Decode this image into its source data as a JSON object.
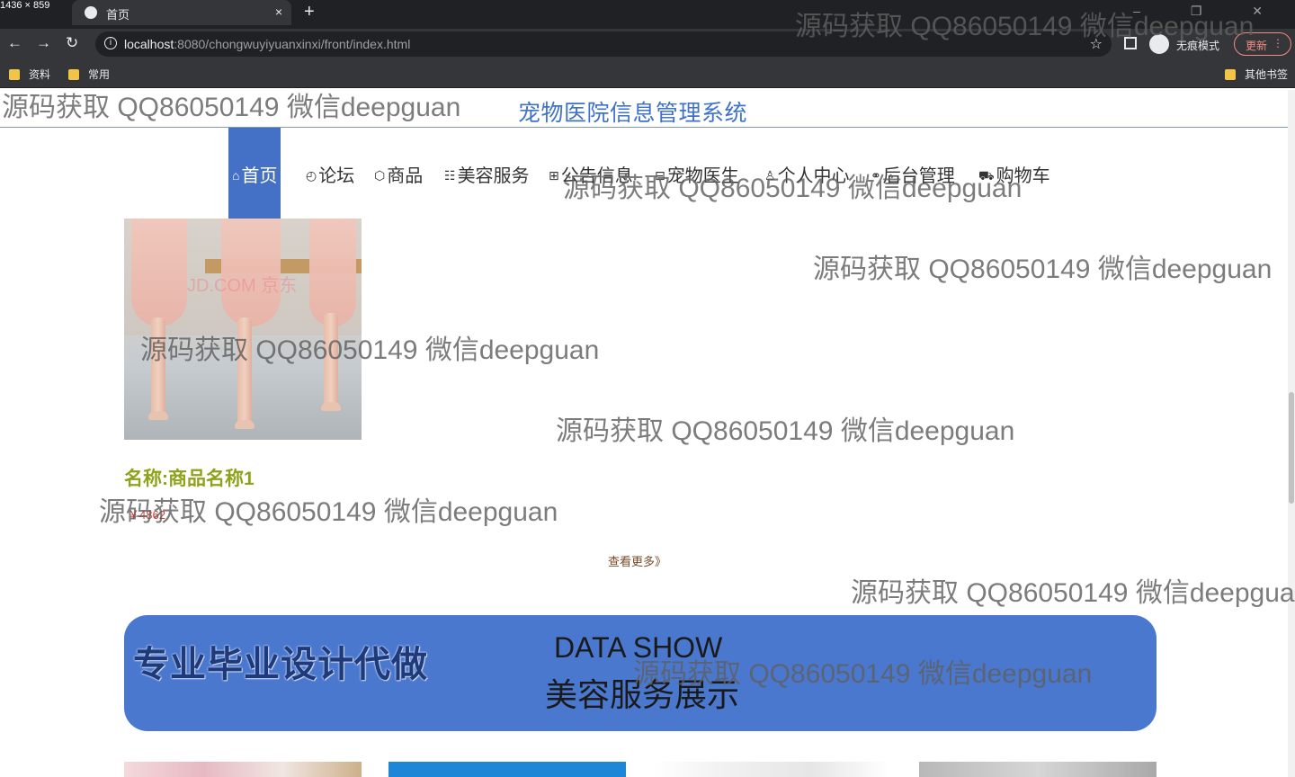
{
  "browser": {
    "corner_label": "1436 × 859",
    "tab_title": "首页",
    "tab_close": "×",
    "new_tab": "+",
    "window_controls": "– ❐ ✕",
    "url_host": "localhost",
    "url_rest": ":8080/chongwuyiyuanxinxi/front/index.html",
    "incognito_label": "无痕模式",
    "update_label": "更新",
    "bookmarks": [
      "资料",
      "常用"
    ],
    "other_bookmarks": "其他书签"
  },
  "site": {
    "title": "宠物医院信息管理系统"
  },
  "nav": {
    "items": [
      {
        "label": "首页",
        "icon": "home-icon",
        "active": true
      },
      {
        "label": "论坛",
        "icon": "clock-icon"
      },
      {
        "label": "商品",
        "icon": "box-icon"
      },
      {
        "label": "美容服务",
        "icon": "list-icon"
      },
      {
        "label": "公告信息",
        "icon": "grid-icon"
      },
      {
        "label": "宠物医生",
        "icon": "grid-icon"
      },
      {
        "label": "个人中心",
        "icon": "user-icon"
      },
      {
        "label": "后台管理",
        "icon": "link-icon"
      },
      {
        "label": "购物车",
        "icon": "cart-icon"
      }
    ]
  },
  "product": {
    "image_watermark": "JD.COM 京东",
    "name": "名称:商品名称1",
    "price": "￥4862"
  },
  "more_link": "查看更多》",
  "banner": {
    "left_text": "专业毕业设计代做",
    "title_en": "DATA SHOW",
    "title_cn": "美容服务展示"
  },
  "watermark": "源码获取 QQ86050149 微信deepguan",
  "colors": {
    "accent": "#4470c6",
    "title": "#3f72c9",
    "banner": "#4a78cf",
    "product_name": "#8fa31a",
    "price": "#d63a3a"
  }
}
